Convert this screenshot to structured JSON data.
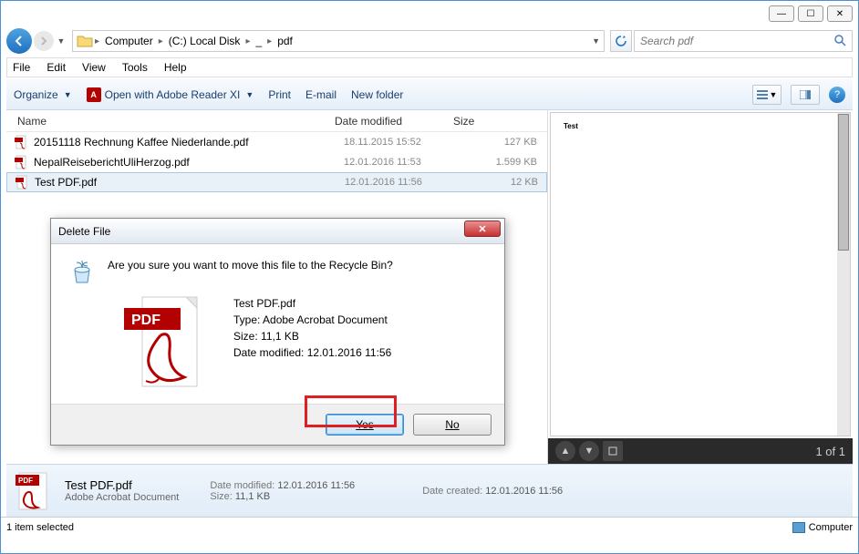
{
  "window_buttons": {
    "min": "—",
    "max": "☐",
    "close": "✕"
  },
  "breadcrumb": {
    "root": "Computer",
    "drive": "(C:) Local Disk",
    "mid": "_",
    "folder": "pdf"
  },
  "search": {
    "placeholder": "Search pdf"
  },
  "menubar": [
    "File",
    "Edit",
    "View",
    "Tools",
    "Help"
  ],
  "toolbar": {
    "organize": "Organize",
    "open_with": "Open with Adobe Reader XI",
    "print": "Print",
    "email": "E-mail",
    "new_folder": "New folder"
  },
  "columns": {
    "name": "Name",
    "date": "Date modified",
    "size": "Size"
  },
  "files": [
    {
      "name": "20151118 Rechnung Kaffee Niederlande.pdf",
      "date": "18.11.2015 15:52",
      "size": "127 KB",
      "selected": false
    },
    {
      "name": "NepalReiseberichtUliHerzog.pdf",
      "date": "12.01.2016 11:53",
      "size": "1.599 KB",
      "selected": false
    },
    {
      "name": "Test PDF.pdf",
      "date": "12.01.2016 11:56",
      "size": "12 KB",
      "selected": true
    }
  ],
  "preview": {
    "content": "Test",
    "page": "1 of 1"
  },
  "details": {
    "filename": "Test PDF.pdf",
    "type": "Adobe Acrobat Document",
    "modified_label": "Date modified:",
    "modified": "12.01.2016 11:56",
    "size_label": "Size:",
    "size": "11,1 KB",
    "created_label": "Date created:",
    "created": "12.01.2016 11:56"
  },
  "statusbar": {
    "left": "1 item selected",
    "right": "Computer"
  },
  "dialog": {
    "title": "Delete File",
    "message": "Are you sure you want to move this file to the Recycle Bin?",
    "file_name": "Test PDF.pdf",
    "file_type_label": "Type:",
    "file_type": "Adobe Acrobat Document",
    "file_size_label": "Size:",
    "file_size": "11,1 KB",
    "file_date_label": "Date modified:",
    "file_date": "12.01.2016 11:56",
    "yes": "Yes",
    "no": "No"
  }
}
